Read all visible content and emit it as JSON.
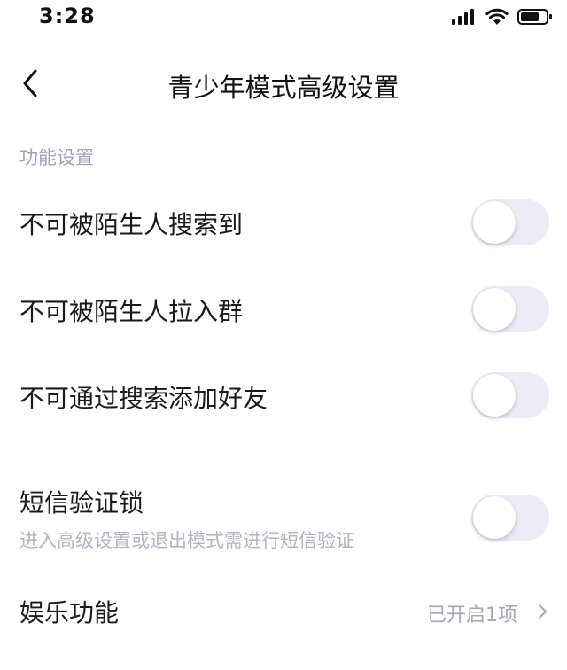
{
  "status_bar": {
    "time": "3:28",
    "icons": [
      "signal-icon",
      "wifi-icon",
      "battery-icon"
    ]
  },
  "nav": {
    "back_icon": "chevron-left-icon",
    "title": "青少年模式高级设置"
  },
  "section": {
    "title": "功能设置"
  },
  "settings": [
    {
      "label": "不可被陌生人搜索到",
      "enabled": false
    },
    {
      "label": "不可被陌生人拉入群",
      "enabled": false
    },
    {
      "label": "不可通过搜索添加好友",
      "enabled": false
    },
    {
      "label": "短信验证锁",
      "description": "进入高级设置或退出模式需进行短信验证",
      "enabled": false
    }
  ],
  "entertainment": {
    "label": "娱乐功能",
    "value": "已开启1项",
    "chevron_icon": "chevron-right-icon"
  },
  "colors": {
    "toggle_track_off": "#ecebf6",
    "muted_text": "#9ea3b8"
  }
}
